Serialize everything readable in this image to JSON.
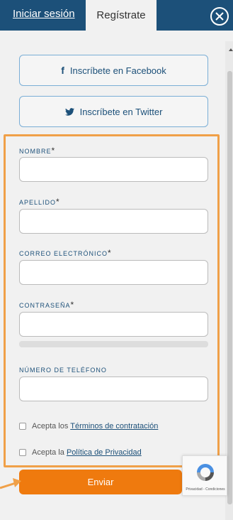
{
  "tabs": {
    "login": "Iniciar sesión",
    "register": "Regístrate"
  },
  "social": {
    "facebook_label": "Inscríbete en Facebook",
    "facebook_icon": "f",
    "twitter_label": "Inscríbete en Twitter"
  },
  "form": {
    "nombre_label": "NOMBRE",
    "apellido_label": "APELLIDO",
    "correo_label": "CORREO ELECTRÓNICO",
    "contrasena_label": "CONTRASEÑA",
    "telefono_label": "NÚMERO DE TELÉFONO",
    "required_mark": "*",
    "nombre_value": "",
    "apellido_value": "",
    "correo_value": "",
    "contrasena_value": "",
    "telefono_value": "",
    "terms_prefix": "Acepta los",
    "terms_link": "Términos de contratación",
    "privacy_prefix": "Acepta la",
    "privacy_link": "Política de Privacidad",
    "submit_label": "Enviar"
  },
  "recaptcha": {
    "links": "Privacidad - Condiciones"
  },
  "colors": {
    "header": "#1c5079",
    "accent": "#ef7a0e",
    "highlight": "#f0a048",
    "link": "#1c5079"
  }
}
